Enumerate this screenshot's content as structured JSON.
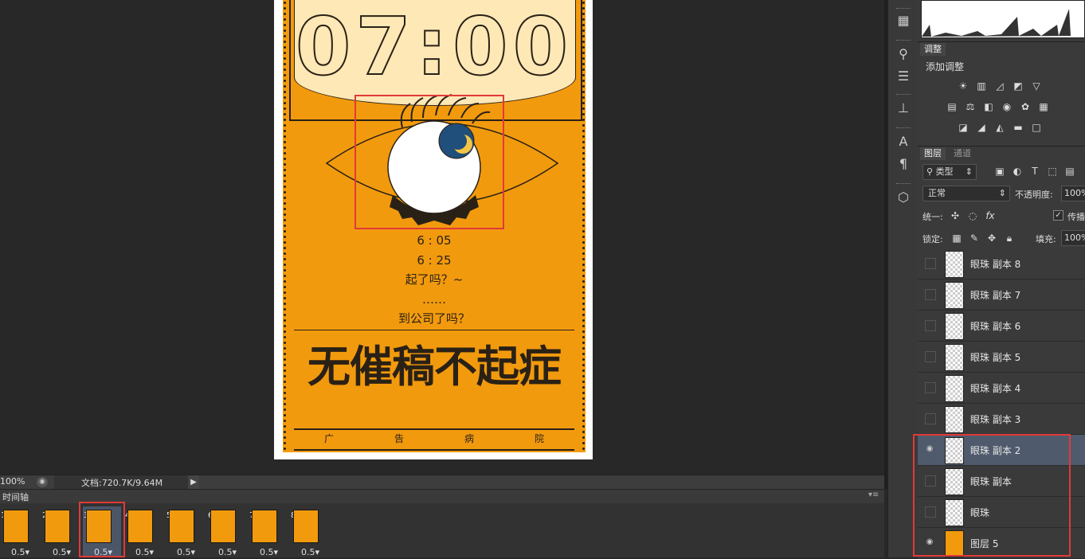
{
  "poster": {
    "time": "07:00",
    "lines": [
      "6 : 05",
      "6 : 25",
      "起了吗？~",
      "……",
      "到公司了吗？"
    ],
    "headline": "无催稿不起症",
    "footer": [
      "广",
      "告",
      "病",
      "院"
    ],
    "colors": {
      "orange": "#f29a0d",
      "dark": "#2a2116",
      "cream": "#fde8b6",
      "moon_bg": "#1f4f7a",
      "moon": "#f4c447"
    }
  },
  "status_bar": {
    "zoom": "100%",
    "doc_info": "文档:720.7K/9.64M"
  },
  "timeline": {
    "title": "时间轴",
    "frames": [
      {
        "num": "1",
        "delay": "0.5"
      },
      {
        "num": "2",
        "delay": "0.5"
      },
      {
        "num": "3",
        "delay": "0.5"
      },
      {
        "num": "4",
        "delay": "0.5"
      },
      {
        "num": "5",
        "delay": "0.5"
      },
      {
        "num": "6",
        "delay": "0.5"
      },
      {
        "num": "7",
        "delay": "0.5"
      },
      {
        "num": "8",
        "delay": "0.5"
      }
    ],
    "selected_frame": 3
  },
  "adjustments": {
    "tab": "调整",
    "subtitle": "添加调整"
  },
  "layers_panel": {
    "tab_layers": "图层",
    "tab_channels": "通道",
    "filter_type": "类型",
    "blend_mode": "正常",
    "opacity_label": "不透明度:",
    "opacity_value": "100%",
    "unify_label": "统一:",
    "propagate_label": "传播",
    "lock_label": "锁定:",
    "fill_label": "填充:",
    "fill_value": "100%",
    "layers": [
      {
        "name": "眼珠 副本 8",
        "visible": false
      },
      {
        "name": "眼珠 副本 7",
        "visible": false
      },
      {
        "name": "眼珠 副本 6",
        "visible": false
      },
      {
        "name": "眼珠 副本 5",
        "visible": false
      },
      {
        "name": "眼珠 副本 4",
        "visible": false
      },
      {
        "name": "眼珠 副本 3",
        "visible": false
      },
      {
        "name": "眼珠 副本 2",
        "visible": true
      },
      {
        "name": "眼珠 副本",
        "visible": false
      },
      {
        "name": "眼珠",
        "visible": false
      },
      {
        "name": "图层 5",
        "visible": true
      }
    ],
    "selected_layer": "眼珠 副本 2"
  },
  "annotation_color": "#e03a3a"
}
